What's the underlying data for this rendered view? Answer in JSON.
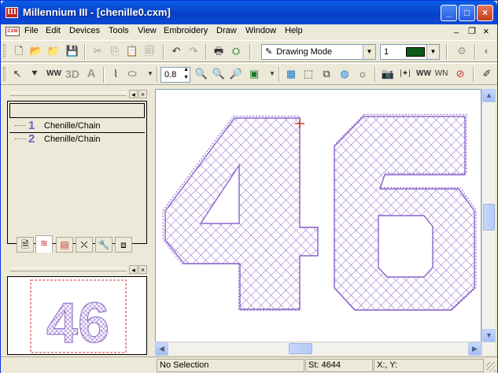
{
  "window": {
    "title": "Millennium III - [chenille0.cxm]",
    "app_icon_text": "III",
    "minimize": "_",
    "maximize": "□",
    "close": "×"
  },
  "menubar": {
    "doc_icon": "CXM",
    "items": [
      "File",
      "Edit",
      "Devices",
      "Tools",
      "View",
      "Embroidery",
      "Draw",
      "Window",
      "Help"
    ],
    "mdi_minimize": "_",
    "mdi_restore": "❐",
    "mdi_close": "×"
  },
  "toolbar1": {
    "mode_combo": "Drawing Mode",
    "color_index_combo": "1",
    "color_swatch": "#0b5a1a"
  },
  "toolbar2": {
    "line_width": "0.8"
  },
  "stitch_list": {
    "header": "",
    "items": [
      {
        "number": "1",
        "label": "Chenille/Chain"
      },
      {
        "number": "2",
        "label": "Chenille/Chain"
      }
    ]
  },
  "design": {
    "text": "46",
    "stitch_color": "#8a63c9"
  },
  "status": {
    "selection": "No Selection",
    "stitches": "St: 4644",
    "coords": "X:, Y:"
  },
  "colors": {
    "titlebar": "#0a5fe8",
    "stitch": "#8a63c9",
    "preview_border": "#d03030"
  }
}
